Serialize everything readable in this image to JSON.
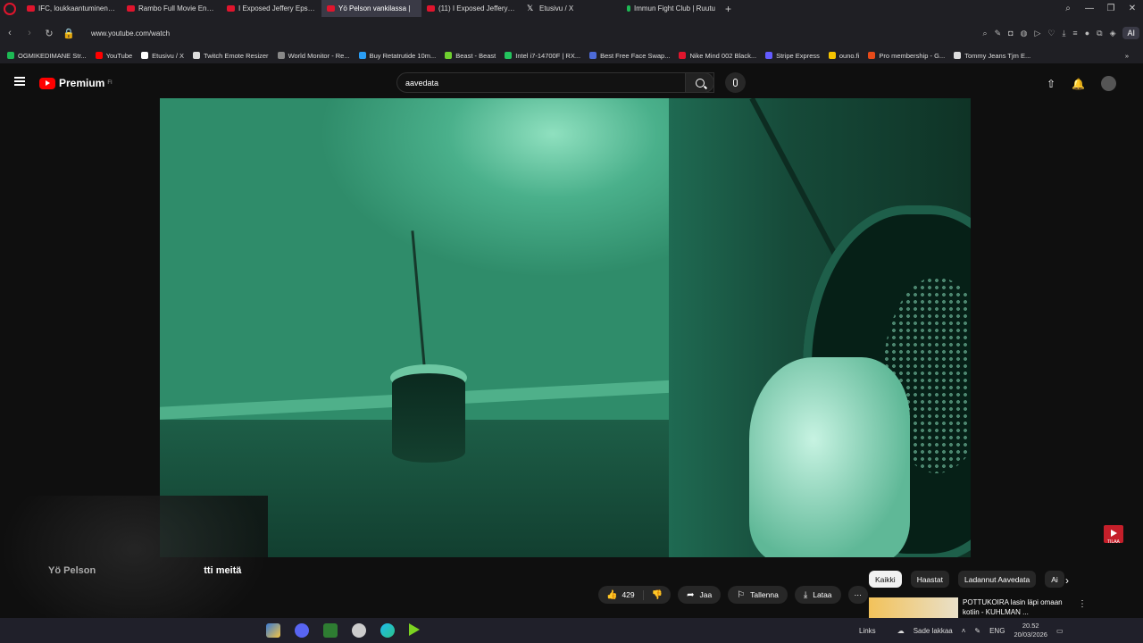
{
  "browser": {
    "tabs": [
      {
        "title": "IFC, loukkaantuminen & V",
        "icon": "youtube-icon",
        "active": false
      },
      {
        "title": "Rambo Full Movie English",
        "icon": "youtube-icon",
        "active": false
      },
      {
        "title": "I Exposed Jeffery Epstein",
        "icon": "youtube-icon",
        "active": false
      },
      {
        "title": "Yö Pelson vankilassa |",
        "icon": "youtube-icon",
        "active": true
      },
      {
        "title": "(11) I Exposed Jeffery Epst",
        "icon": "youtube-icon",
        "active": false
      },
      {
        "title": "Etusivu / X",
        "icon": "x-icon",
        "active": false
      },
      {
        "title": "Immun Fight Club | Ruutu",
        "icon": "ruutu-icon",
        "active": false
      }
    ],
    "url": "www.youtube.com/watch",
    "toolbar_ai_label": "AI",
    "bookmarks": [
      "OGMIKEDIMANE Str...",
      "YouTube",
      "Etusivu / X",
      "Twitch Emote Resizer",
      "World Monitor - Re...",
      "Buy Retatrutide 10m...",
      "Beast - Beast",
      "Intel i7-14700F | RX...",
      "Best Free Face Swap...",
      "Nike Mind 002 Black...",
      "Stripe Express",
      "ouno.fi",
      "Pro membership - G...",
      "Tommy Jeans Tjm E..."
    ]
  },
  "youtube": {
    "logo_text": "Premium",
    "logo_sup": "FI",
    "search_value": "aavedata",
    "video_title_start": "Yö Pelson",
    "video_title_end": "tti meitä",
    "actions": {
      "likes": "429",
      "share": "Jaa",
      "save": "Tallenna",
      "download": "Lataa"
    },
    "chips": [
      "Kaikki",
      "Haastat",
      "Ladannut Aavedata",
      "Ai"
    ],
    "subscribe_watermark": "TILAA",
    "recommendation": {
      "title": "POTTUKOIRA lasin läpi omaan kotiin - KUHLMAN ..."
    }
  },
  "taskbar": {
    "links_label": "Links",
    "weather": "Sade lakkaa",
    "lang": "ENG",
    "time": "20.52",
    "date": "20/03/2026"
  }
}
